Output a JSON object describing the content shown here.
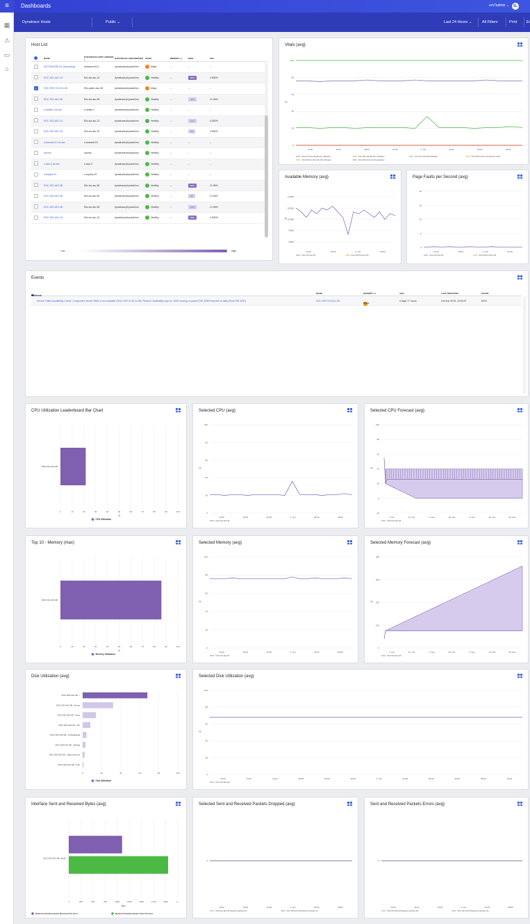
{
  "topbar": {
    "title": "Dashboards",
    "user": "em7admin ⌄",
    "logo_text": "ScienceLogic",
    "logo_badge": "SL"
  },
  "subbar": {
    "name": "Dynatrace Hosts",
    "visibility": "Public",
    "time": "Last 24 Hours",
    "filters": "All Filters",
    "print": "Print",
    "edit": "Ed"
  },
  "host_list": {
    "title": "Host List",
    "columns": [
      "NAME",
      "DYNATRACE HOST | SERVER I",
      "DYNATRACE HOST/SERVER",
      "STATE",
      "MEMORY ▲",
      "DISK",
      "CPU"
    ],
    "rows": [
      {
        "name": "AUTOAZURE111.sciencelogi",
        "host": "autoazure113",
        "type": "dynatrace/physical/mo",
        "state": "Major",
        "memory": "--",
        "disk": "--",
        "cpu": "--",
        "checked": false
      },
      {
        "name": "SOC-ISO-AIO-10",
        "host": "50c-iso-aio-10",
        "type": "dynatrace/physical/mo",
        "state": "Healthy",
        "memory": "--",
        "disk": "68%",
        "cpu": "4.550%",
        "checked": false
      },
      {
        "name": "SOC-PATCH-DCU-28",
        "host": "50c-patch-dcu-28",
        "type": "dynatrace/physical/mo",
        "state": "Major",
        "memory": "--",
        "disk": "--",
        "cpu": "--",
        "checked": true
      },
      {
        "name": "SOC-ISO-AIO-38",
        "host": "50c-iso-aio-38",
        "type": "dynatrace/physical/mo",
        "state": "Healthy",
        "memory": "--",
        "disk": "32%",
        "cpu": "21.56%",
        "checked": false
      },
      {
        "name": "s-hellas-1.de.lan",
        "host": "s-hellas-1",
        "type": "dynatrace/physical/mo",
        "state": "Healthy",
        "memory": "--",
        "disk": "--",
        "cpu": "--",
        "checked": false
      },
      {
        "name": "SOC-ISO-AIO-13",
        "host": "50c-iso-aio-13",
        "type": "dynatrace/physical/mo",
        "state": "Healthy",
        "memory": "--",
        "disk": "12%",
        "cpu": "4.550%",
        "checked": false
      },
      {
        "name": "SOC-ISO-AIO-15",
        "host": "50c-iso-aio-15",
        "type": "dynatrace/physical/mo",
        "state": "Healthy",
        "memory": "--",
        "disk": "3%",
        "cpu": "4.550%",
        "checked": false
      },
      {
        "name": "s-docweb-01.de.lan",
        "host": "s-docweb-01",
        "type": "dynatrace/physical/mo",
        "state": "Healthy",
        "memory": "--",
        "disk": "--",
        "cpu": "--",
        "checked": false
      },
      {
        "name": "ubuntu",
        "host": "ubuntu",
        "type": "dynatrace/physical/mo",
        "state": "Healthy",
        "memory": "--",
        "disk": "--",
        "cpu": "--",
        "checked": false
      },
      {
        "name": "c-ssw-2.de.lan",
        "host": "c-ssw-2",
        "type": "dynatrace/physical/mo",
        "state": "Healthy",
        "memory": "--",
        "disk": "--",
        "cpu": "--",
        "checked": false
      },
      {
        "name": "s-replica-02",
        "host": "s-replica-02",
        "type": "dynatrace/physical/mo",
        "state": "Healthy",
        "memory": "--",
        "disk": "--",
        "cpu": "--",
        "checked": false
      },
      {
        "name": "SOC-ISO-AIO-38",
        "host": "50c-iso-aio-38",
        "type": "dynatrace/physical/mo",
        "state": "Healthy",
        "memory": "--",
        "disk": "68%",
        "cpu": "21.56%",
        "checked": false
      },
      {
        "name": "SOC-ISO-AIO-38",
        "host": "50c-iso-aio-38",
        "type": "dynatrace/physical/mo",
        "state": "Healthy",
        "memory": "--",
        "disk": "3%",
        "cpu": "21.56%",
        "checked": false
      },
      {
        "name": "SOC-ISO-AIO-38",
        "host": "50c-iso-aio-38",
        "type": "dynatrace/physical/mo",
        "state": "Healthy",
        "memory": "--",
        "disk": "14%",
        "cpu": "21.56%",
        "checked": false
      },
      {
        "name": "SOC-ISO-AIO-10",
        "host": "50c-iso-aio-10",
        "type": "dynatrace/physical/mo",
        "state": "Healthy",
        "memory": "--",
        "disk": "59%",
        "cpu": "4.550%",
        "checked": false
      }
    ],
    "legend_low": "Low",
    "legend_high": "High"
  },
  "events": {
    "title": "Events",
    "columns": [
      "MESSAGE",
      "NAME",
      "SEVERITY ▲",
      "AGE",
      "LAST DETECTED",
      "COUNT"
    ],
    "rows": [
      {
        "message": "Device Failed Availability Check: Component device 3365 is not available (SOC-PATCH-DCU-28); Reason: Availability App ID: 1505 running on parent DID 3258 returned no data (Root DID 3257)",
        "name": "SOC-PATCH-DCU-28",
        "severity": "Major",
        "age": "4 days 17 hours",
        "last": "Oct 2nd 2019, 10:54:07",
        "count": "6016"
      }
    ]
  },
  "colors": {
    "purple": "#7f5fb0",
    "purple_light": "#d2c6ea",
    "green": "#4cb944",
    "orange": "#f7870f",
    "blue": "#3b64e0",
    "red": "#d94a4a"
  },
  "chart_data": [
    {
      "id": "vitals",
      "title": "Vitals (avg)",
      "type": "line",
      "ylabel": "%",
      "ylim": [
        0,
        100
      ],
      "yticks": [
        0,
        20,
        40,
        60,
        80,
        100
      ],
      "xticks": [
        "12:00",
        "15:00",
        "18:00",
        "21:00",
        "2. Oct",
        "03:00",
        "06:00",
        "09:00"
      ],
      "series": [
        {
          "name": "SOC-ISO-AIO-38 Memory Utilization",
          "color": "#7f5fb0",
          "values": [
            76,
            76,
            75,
            76,
            76,
            76,
            77,
            76,
            76,
            76,
            77,
            76,
            76,
            76,
            76,
            76,
            77,
            76,
            76,
            76
          ]
        },
        {
          "name": "SOC-ISO-AIO-38 CPU Utilization",
          "color": "#4cb944",
          "values": [
            21,
            21,
            20,
            21,
            21,
            20,
            21,
            21,
            21,
            21,
            20,
            34,
            21,
            21,
            21,
            20,
            21,
            21,
            22,
            21
          ]
        },
        {
          "name": "SOC-ISO-AIO-38 Availability",
          "color": "#4cb944",
          "values": [
            100,
            100,
            100,
            100,
            100,
            100,
            100,
            100,
            100,
            100,
            100,
            100,
            100,
            100,
            100,
            100,
            100,
            100,
            100,
            100
          ]
        },
        {
          "name": "SOC-PATCH-DCU-28 Memory Utiliz...",
          "color": "#f7870f",
          "values": [
            0,
            0,
            0,
            0,
            0,
            0,
            0,
            0,
            0,
            0,
            0,
            0,
            0,
            0,
            0,
            0,
            0,
            0,
            0,
            0
          ]
        },
        {
          "name": "SOC-PATCH-DCU-28 CPU Utilization",
          "color": "#f7870f",
          "values": [
            0,
            0,
            0,
            0,
            0,
            0,
            0,
            0,
            0,
            0,
            0,
            0,
            0,
            0,
            0,
            0,
            0,
            0,
            0,
            0
          ]
        },
        {
          "name": "SOC-PATCH-DCU-28 Availability",
          "color": "#d94a4a",
          "values": [
            0,
            0,
            0,
            0,
            0,
            0,
            0,
            0,
            0,
            0,
            0,
            0,
            0,
            0,
            0,
            0,
            0,
            0,
            0,
            0
          ]
        }
      ]
    },
    {
      "id": "avail_mem",
      "title": "Available Memory (avg)",
      "type": "line",
      "ylabel": "B",
      "ylim": [
        850,
        1150
      ],
      "yticks": [
        "900M",
        "950M",
        "1000M",
        "1050M",
        "1100M"
      ],
      "xticks": [
        "12:00",
        "18:00",
        "2. Oct",
        "06:00"
      ],
      "series": [
        {
          "name": "SOC-ISO-AIO-38",
          "color": "#7f5fb0",
          "values": [
            1060,
            1040,
            1010,
            1050,
            1030,
            1060,
            1050,
            1070,
            1040,
            1010,
            920,
            1040,
            1030,
            1050,
            1030,
            1010,
            1040,
            1000,
            1030,
            1020
          ]
        },
        {
          "name": "SOC-PATCH-DCU-28",
          "color": "#f7870f",
          "values": []
        }
      ]
    },
    {
      "id": "page_faults",
      "title": "Page Faults per Second (avg)",
      "type": "line",
      "ylim": [
        0,
        20
      ],
      "yticks": [
        0,
        5,
        10,
        15,
        20
      ],
      "xticks": [
        "12:00",
        "18:00",
        "2. Oct",
        "06:00"
      ],
      "series": [
        {
          "name": "SOC-ISO-AIO-38",
          "color": "#7f5fb0",
          "values": [
            0.2,
            0.2,
            0.3,
            0.2,
            0.2,
            0.3,
            0.2,
            0.2,
            0.2,
            0.3,
            0.2,
            0.2,
            0.2,
            0.3,
            0.2,
            0.2,
            0.2,
            0.2,
            0.2,
            0.2
          ]
        },
        {
          "name": "SOC-PATCH-DCU-28",
          "color": "#f7870f",
          "values": []
        }
      ]
    },
    {
      "id": "cpu_leader",
      "title": "CPU Utilization Leaderboard Bar Chart",
      "type": "bar",
      "horizontal": true,
      "categories": [
        "SOC-ISO-AIO-38"
      ],
      "values": [
        21.56
      ],
      "xlim": [
        0,
        100
      ],
      "xlabel": "%",
      "legend": "CPU Utilization",
      "color": "#7f5fb0"
    },
    {
      "id": "sel_cpu",
      "title": "Selected CPU (avg)",
      "type": "line",
      "ylabel": "%",
      "ylim": [
        0,
        100
      ],
      "yticks": [
        0,
        20,
        40,
        60,
        80,
        100
      ],
      "xticks": [
        "12:00",
        "16:00",
        "20:00",
        "2. Oct",
        "04:00",
        "08:00"
      ],
      "series": [
        {
          "name": "SOC-ISO-AIO-38",
          "color": "#7f5fb0",
          "values": [
            21,
            21,
            20,
            21,
            21,
            20,
            21,
            21,
            21,
            21,
            20,
            36,
            21,
            21,
            21,
            20,
            21,
            21,
            22,
            21
          ]
        }
      ]
    },
    {
      "id": "cpu_forecast",
      "title": "Selected CPU Forecast (avg)",
      "type": "area",
      "ylabel": "%",
      "ylim": [
        -20,
        100
      ],
      "yticks": [
        -20,
        0,
        20,
        40,
        60,
        80,
        100
      ],
      "xticks": [
        "7. Oct",
        "21. Oct",
        "4. Nov",
        "18. Nov",
        "2. Dec",
        "16. Dec",
        "30. Dec"
      ],
      "series": [
        {
          "name": "SOC-ISO-AIO-38",
          "color": "#7f5fb0",
          "values": [
            21,
            26,
            26,
            26,
            26,
            26,
            26
          ]
        }
      ]
    },
    {
      "id": "top_mem",
      "title": "Top 10 - Memory (max)",
      "type": "bar",
      "horizontal": true,
      "categories": [
        "SOC-ISO-AIO-38"
      ],
      "values": [
        86
      ],
      "xlim": [
        0,
        100
      ],
      "xlabel": "%",
      "legend": "Memory Utilization",
      "color": "#7f5fb0"
    },
    {
      "id": "sel_mem",
      "title": "Selected Memory (avg)",
      "type": "line",
      "ylabel": "%",
      "ylim": [
        0,
        100
      ],
      "yticks": [
        0,
        20,
        40,
        60,
        80,
        100
      ],
      "xticks": [
        "12:00",
        "16:00",
        "20:00",
        "2. Oct",
        "04:00",
        "08:00"
      ],
      "series": [
        {
          "name": "SOC-ISO-AIO-38",
          "color": "#7f5fb0",
          "values": [
            76,
            76,
            76,
            77,
            76,
            76,
            76,
            76,
            76,
            76,
            76,
            78,
            76,
            76,
            77,
            76,
            76,
            76,
            77,
            76
          ]
        }
      ]
    },
    {
      "id": "mem_forecast",
      "title": "Selected Memory Forecast (avg)",
      "type": "area",
      "ylabel": "%",
      "ylim": [
        0,
        400
      ],
      "yticks": [
        0,
        100,
        200,
        300,
        400
      ],
      "xticks": [
        "7. Oct",
        "21. Oct",
        "4. Nov",
        "18. Nov",
        "2. Dec",
        "16. Dec",
        "30. Dec"
      ],
      "series": [
        {
          "name": "SOC-ISO-AIO-38",
          "color": "#7f5fb0",
          "values": [
            76,
            76,
            76,
            76,
            76,
            76,
            76
          ]
        }
      ]
    },
    {
      "id": "disk_util",
      "title": "Disk Utilization (avg)",
      "type": "bar",
      "horizontal": true,
      "categories": [
        "SOC-ISO-AIO-38 : /",
        "SOC-ISO-AIO-38 : /home",
        "SOC-ISO-AIO-38 : /boot",
        "SOC-ISO-AIO-38 : /usr",
        "SOC-ISO-AIO-38 : /var/log/audit",
        "SOC-ISO-AIO-38 : /var/log",
        "SOC-ISO-AIO-38 : /data.local.nfs",
        "SOC-ISO-AIO-38 : /tmp"
      ],
      "values": [
        68,
        32,
        14,
        8,
        4,
        3,
        2,
        1
      ],
      "xlim": [
        0,
        100
      ],
      "legend": "Disk Utilization",
      "color": "#7f5fb0"
    },
    {
      "id": "sel_disk",
      "title": "Selected Disk Utilization (avg)",
      "type": "line",
      "ylabel": "%",
      "ylim": [
        0,
        100
      ],
      "yticks": [
        0,
        20,
        40,
        60,
        80,
        100
      ],
      "xticks": [
        "12:00",
        "14:00",
        "16:00",
        "18:00",
        "20:00",
        "22:00",
        "2. Oct",
        "02:00",
        "04:00",
        "06:00",
        "08:00",
        "10:00"
      ],
      "series": [
        {
          "name": "SOC-ISO-AIO-38 /",
          "color": "#7f5fb0",
          "values": [
            68,
            68,
            68,
            68,
            68,
            68,
            68,
            68,
            68,
            68,
            68,
            68
          ]
        }
      ]
    },
    {
      "id": "iface",
      "title": "Interface Sent and Received Bytes (avg)",
      "type": "bar",
      "horizontal": true,
      "categories": [
        "SOC-ISO-AIO-38: ens32"
      ],
      "series": [
        {
          "name": "Network Interface Bytes Received On Host",
          "color": "#7f5fb0",
          "values": [
            1100
          ]
        },
        {
          "name": "Network Interface Bytes Sent On Host",
          "color": "#4cb944",
          "values": [
            2050
          ]
        }
      ],
      "xlim": [
        0,
        2250
      ],
      "xticks": [
        "0",
        "250",
        "500",
        "750",
        "1000",
        "1250",
        "1500",
        "1750",
        "2000",
        "2..."
      ],
      "xlabel": "Bps"
    },
    {
      "id": "pkts_drop",
      "title": "Selected Sent and Received Packets Dropped (avg)",
      "type": "line",
      "ylim": [
        -1,
        1
      ],
      "yticks": [
        0
      ],
      "xticks": [
        "12:00",
        "16:00",
        "20:00",
        "2. Oct",
        "04:00",
        "08:00"
      ],
      "series": [
        {
          "name": "SOC-ISO-AIO-38 Network Interface Re...",
          "color": "#4cb944",
          "values": [
            0,
            0,
            0,
            0,
            0,
            0,
            0,
            0,
            0,
            0
          ]
        },
        {
          "name": "SOC-ISO-AIO-38 Network Interface Se...",
          "color": "#7f5fb0",
          "values": [
            0,
            0,
            0,
            0,
            0,
            0,
            0,
            0,
            0,
            0
          ]
        }
      ]
    },
    {
      "id": "pkts_err",
      "title": "Sent and Received Packets Errors (avg)",
      "type": "line",
      "ylim": [
        -1,
        1
      ],
      "yticks": [
        0
      ],
      "xticks": [
        "12:00",
        "16:00",
        "20:00",
        "2. Oct",
        "04:00",
        "08:00"
      ],
      "series": [
        {
          "name": "SOC-ISO-AIO-38 Network Interface Re...",
          "color": "#4cb944",
          "values": [
            0,
            0,
            0,
            0,
            0,
            0,
            0,
            0,
            0,
            0
          ]
        },
        {
          "name": "SOC-ISO-AIO-38 Network Interface Se...",
          "color": "#7f5fb0",
          "values": [
            0,
            0,
            0,
            0,
            0,
            0,
            0,
            0,
            0,
            0
          ]
        }
      ]
    }
  ]
}
